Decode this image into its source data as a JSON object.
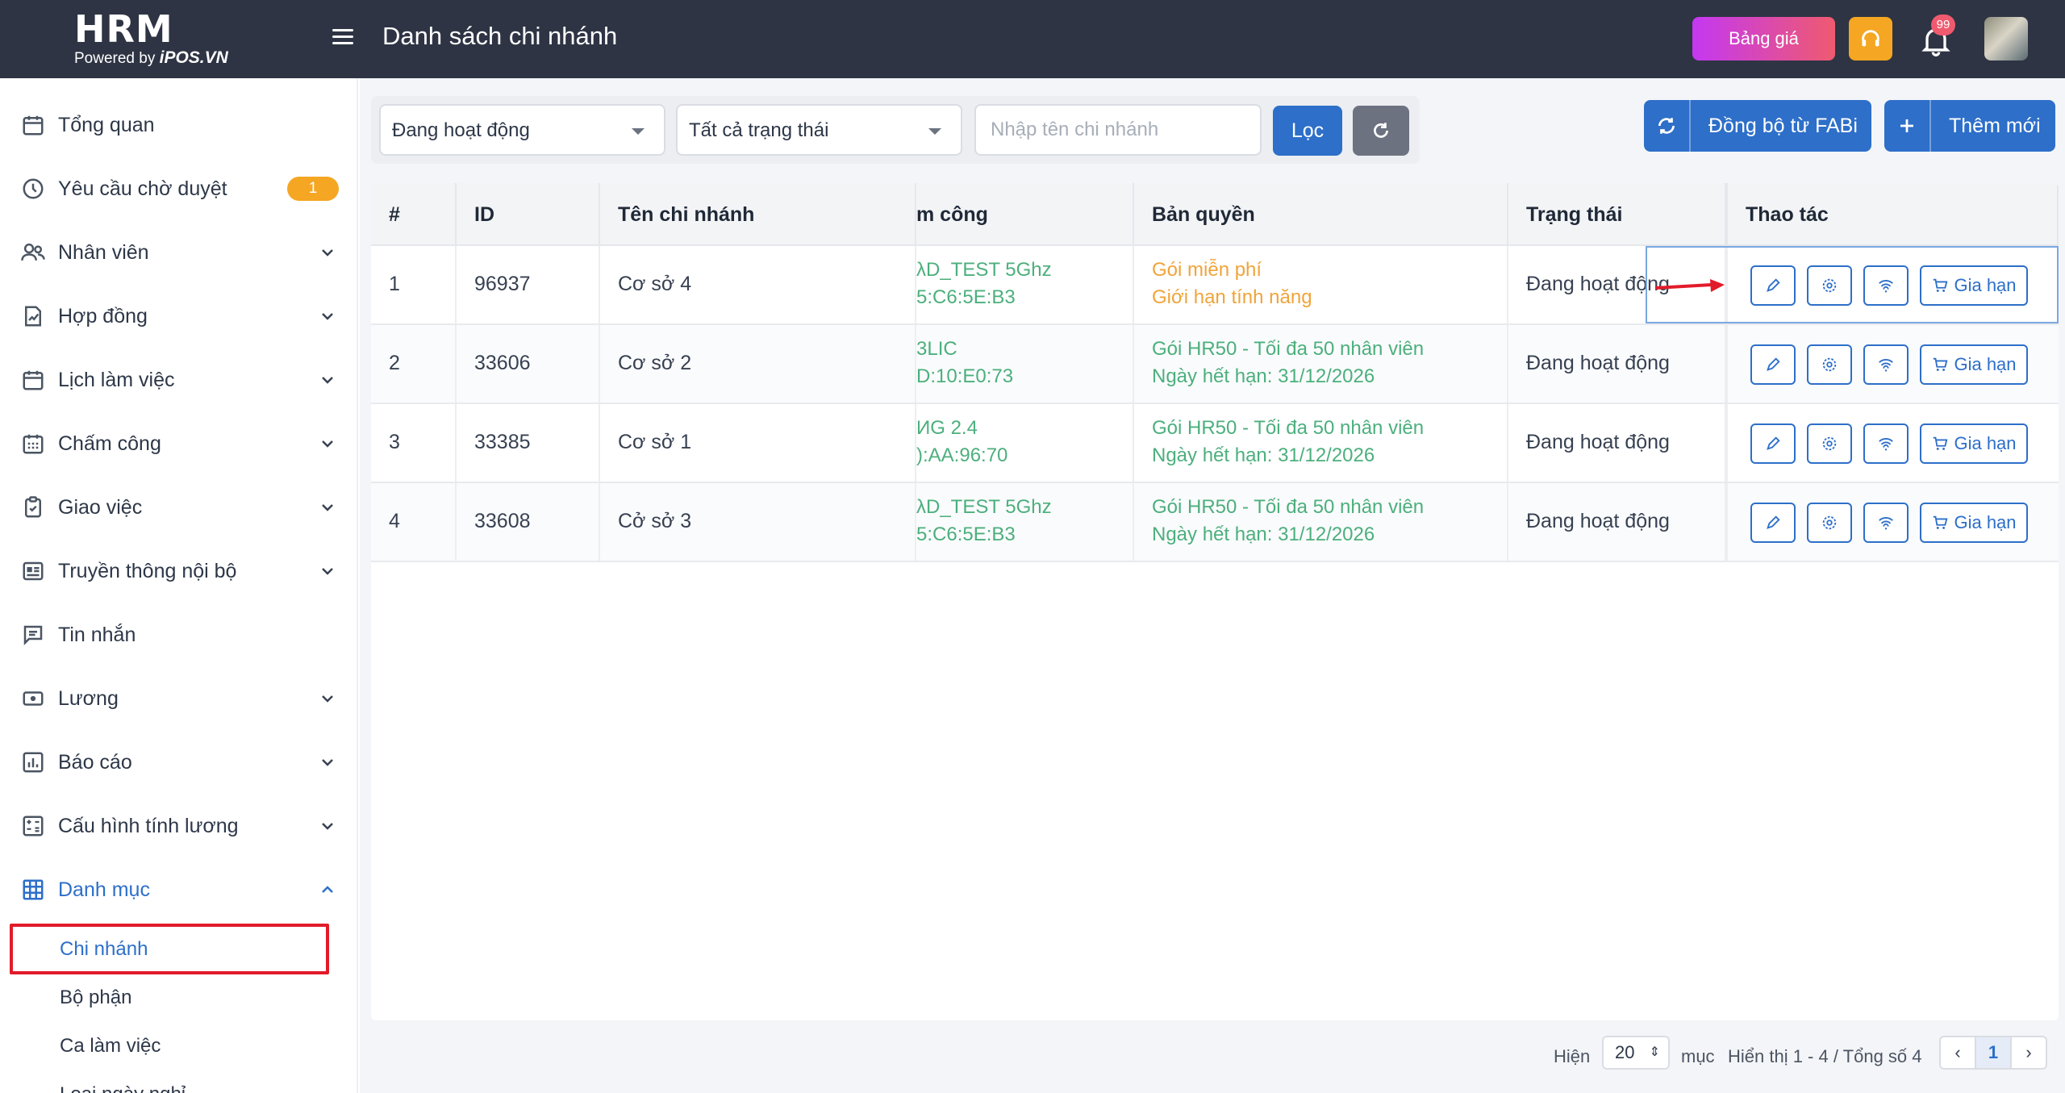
{
  "header": {
    "logo_main": "HRM",
    "logo_powered": "Powered by",
    "logo_brand": "iPOS.VN",
    "title": "Danh sách chi nhánh",
    "pricing_button": "Bảng giá",
    "notification_count": "99"
  },
  "sidebar": {
    "items": [
      {
        "label": "Tổng quan",
        "icon": "calendar-icon"
      },
      {
        "label": "Yêu cầu chờ duyệt",
        "icon": "clock-icon",
        "badge": "1"
      },
      {
        "label": "Nhân viên",
        "icon": "users-icon"
      },
      {
        "label": "Hợp đồng",
        "icon": "contract-icon"
      },
      {
        "label": "Lịch làm việc",
        "icon": "calendar-icon"
      },
      {
        "label": "Chấm công",
        "icon": "timesheet-icon"
      },
      {
        "label": "Giao việc",
        "icon": "clipboard-icon"
      },
      {
        "label": "Truyền thông nội bộ",
        "icon": "newspaper-icon"
      },
      {
        "label": "Tin nhắn",
        "icon": "message-icon"
      },
      {
        "label": "Lương",
        "icon": "money-icon"
      },
      {
        "label": "Báo cáo",
        "icon": "chart-icon"
      },
      {
        "label": "Cấu hình tính lương",
        "icon": "calculator-icon"
      },
      {
        "label": "Danh mục",
        "icon": "grid-icon"
      }
    ],
    "sub_items": [
      {
        "label": "Chi nhánh"
      },
      {
        "label": "Bộ phận"
      },
      {
        "label": "Ca làm việc"
      },
      {
        "label": "Loại ngày nghỉ"
      }
    ]
  },
  "filters": {
    "status_select": "Đang hoạt động",
    "all_status_select": "Tất cả trạng thái",
    "search_placeholder": "Nhập tên chi nhánh",
    "filter_button": "Lọc"
  },
  "actions": {
    "sync_button": "Đồng bộ từ FABi",
    "add_button": "Thêm mới"
  },
  "table": {
    "columns": [
      "#",
      "ID",
      "Tên chi nhánh",
      "m công",
      "Bản quyền",
      "Trạng thái",
      "Thao tác"
    ],
    "renew_label": "Gia hạn",
    "rows": [
      {
        "idx": "1",
        "id": "96937",
        "name": "Cơ sở 4",
        "wifi1": "λD_TEST 5Ghz",
        "wifi2": "5:C6:5E:B3",
        "lic1": "Gói miễn phí",
        "lic2": "Giới hạn tính năng",
        "lic_color": "#f0a43a",
        "status": "Đang hoạt động"
      },
      {
        "idx": "2",
        "id": "33606",
        "name": "Cơ sở 2",
        "wifi1": "3LIC",
        "wifi2": "D:10:E0:73",
        "lic1": "Gói HR50 - Tối đa 50 nhân viên",
        "lic2": "Ngày hết hạn: 31/12/2026",
        "lic_color": "#4caf7d",
        "status": "Đang hoạt động"
      },
      {
        "idx": "3",
        "id": "33385",
        "name": "Cơ sở 1",
        "wifi1": "ИG 2.4",
        "wifi2": "):AA:96:70",
        "lic1": "Gói HR50 - Tối đa 50 nhân viên",
        "lic2": "Ngày hết hạn: 31/12/2026",
        "lic_color": "#4caf7d",
        "status": "Đang hoạt động"
      },
      {
        "idx": "4",
        "id": "33608",
        "name": "Cở sở 3",
        "wifi1": "λD_TEST 5Ghz",
        "wifi2": "5:C6:5E:B3",
        "lic1": "Gói HR50 - Tối đa 50 nhân viên",
        "lic2": "Ngày hết hạn: 31/12/2026",
        "lic_color": "#4caf7d",
        "status": "Đang hoạt động"
      }
    ]
  },
  "pagination": {
    "show_label": "Hiện",
    "page_size": "20",
    "items_label": "mục",
    "summary": "Hiển thị 1 - 4 / Tổng số 4",
    "prev": "‹",
    "current_page": "1",
    "next": "›"
  },
  "colors": {
    "topbar": "#2e3444",
    "accent": "#2d6fc9",
    "success": "#4caf7d",
    "warning": "#f0a43a",
    "highlight": "#e21b2a"
  }
}
